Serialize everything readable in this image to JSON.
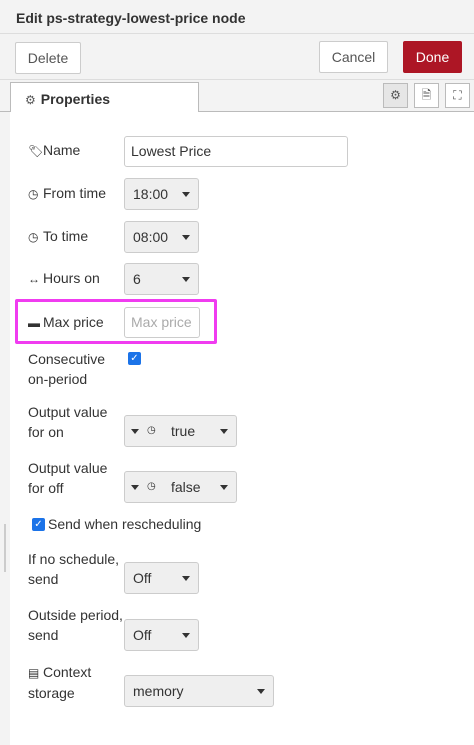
{
  "title": "Edit ps-strategy-lowest-price node",
  "toolbar": {
    "delete_label": "Delete",
    "cancel_label": "Cancel",
    "done_label": "Done"
  },
  "tabs": {
    "properties_label": "Properties"
  },
  "icons": {
    "properties": "gear-icon",
    "settings": "gear-icon",
    "description": "document-icon",
    "appearance": "frame-icon"
  },
  "accent_color": "#ad1625",
  "highlight_color": "#f03cf0",
  "form": {
    "name": {
      "label": "Name",
      "value": "Lowest Price"
    },
    "from_time": {
      "label": "From time",
      "value": "18:00"
    },
    "to_time": {
      "label": "To time",
      "value": "08:00"
    },
    "hours_on": {
      "label": "Hours on",
      "value": "6"
    },
    "max_price": {
      "label": "Max price",
      "placeholder": "Max price"
    },
    "consecutive": {
      "label_line1": "Consecutive",
      "label_line2": "on-period",
      "checked": true
    },
    "output_on": {
      "label_line1": "Output value",
      "label_line2": "for on",
      "value": "true"
    },
    "output_off": {
      "label_line1": "Output value",
      "label_line2": "for off",
      "value": "false"
    },
    "send_rescheduling": {
      "label": "Send when rescheduling",
      "checked": true
    },
    "no_schedule": {
      "label_line1": "If no schedule,",
      "label_line2": "send",
      "value": "Off"
    },
    "outside_period": {
      "label_line1": "Outside period,",
      "label_line2": "send",
      "value": "Off"
    },
    "context_storage": {
      "label_line1": "Context",
      "label_line2": "storage",
      "value": "memory"
    }
  }
}
